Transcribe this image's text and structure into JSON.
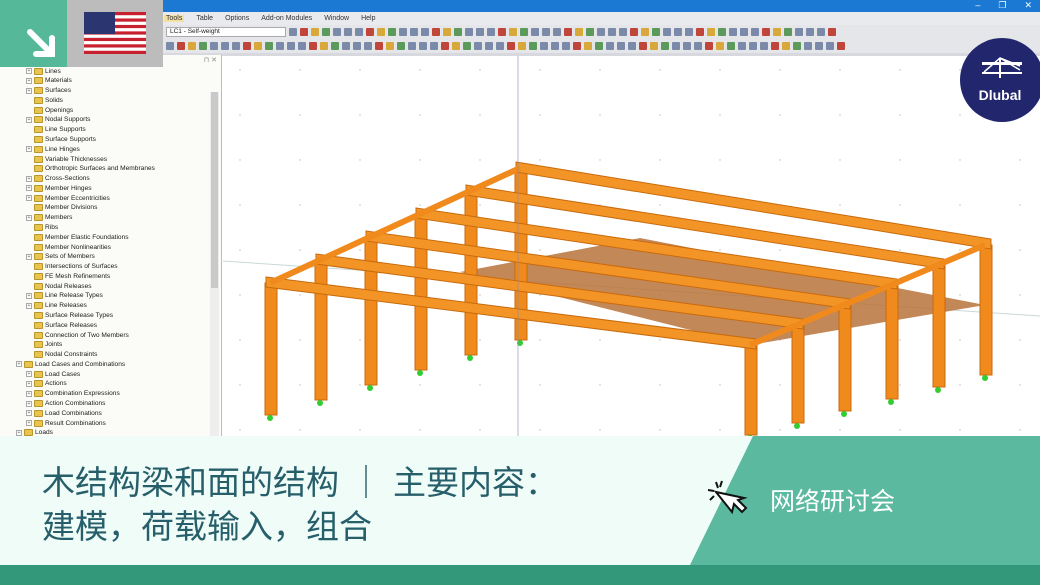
{
  "window": {
    "controls": [
      "–",
      "❐",
      "✕"
    ]
  },
  "menu": [
    "Tools",
    "Table",
    "Options",
    "Add-on Modules",
    "Window",
    "Help"
  ],
  "toolbar": {
    "load_case": "LC1 - Self-weight"
  },
  "panel": {
    "header_icons": "⊓ ✕"
  },
  "tree": [
    {
      "label": "Lines",
      "level": 2,
      "exp": true
    },
    {
      "label": "Materials",
      "level": 2,
      "exp": true
    },
    {
      "label": "Surfaces",
      "level": 2,
      "exp": true
    },
    {
      "label": "Solids",
      "level": 2,
      "exp": false
    },
    {
      "label": "Openings",
      "level": 2,
      "exp": false
    },
    {
      "label": "Nodal Supports",
      "level": 2,
      "exp": true
    },
    {
      "label": "Line Supports",
      "level": 2,
      "exp": false
    },
    {
      "label": "Surface Supports",
      "level": 2,
      "exp": false
    },
    {
      "label": "Line Hinges",
      "level": 2,
      "exp": true
    },
    {
      "label": "Variable Thicknesses",
      "level": 2,
      "exp": false
    },
    {
      "label": "Orthotropic Surfaces and Membranes",
      "level": 2,
      "exp": false
    },
    {
      "label": "Cross-Sections",
      "level": 2,
      "exp": true
    },
    {
      "label": "Member Hinges",
      "level": 2,
      "exp": true
    },
    {
      "label": "Member Eccentricities",
      "level": 2,
      "exp": true
    },
    {
      "label": "Member Divisions",
      "level": 2,
      "exp": false
    },
    {
      "label": "Members",
      "level": 2,
      "exp": true
    },
    {
      "label": "Ribs",
      "level": 2,
      "exp": false
    },
    {
      "label": "Member Elastic Foundations",
      "level": 2,
      "exp": false
    },
    {
      "label": "Member Nonlinearities",
      "level": 2,
      "exp": false
    },
    {
      "label": "Sets of Members",
      "level": 2,
      "exp": true
    },
    {
      "label": "Intersections of Surfaces",
      "level": 2,
      "exp": false
    },
    {
      "label": "FE Mesh Refinements",
      "level": 2,
      "exp": false
    },
    {
      "label": "Nodal Releases",
      "level": 2,
      "exp": false
    },
    {
      "label": "Line Release Types",
      "level": 2,
      "exp": true
    },
    {
      "label": "Line Releases",
      "level": 2,
      "exp": true
    },
    {
      "label": "Surface Release Types",
      "level": 2,
      "exp": false
    },
    {
      "label": "Surface Releases",
      "level": 2,
      "exp": false
    },
    {
      "label": "Connection of Two Members",
      "level": 2,
      "exp": false
    },
    {
      "label": "Joints",
      "level": 2,
      "exp": false
    },
    {
      "label": "Nodal Constraints",
      "level": 2,
      "exp": false
    },
    {
      "label": "Load Cases and Combinations",
      "level": 1,
      "exp": true
    },
    {
      "label": "Load Cases",
      "level": 2,
      "exp": true
    },
    {
      "label": "Actions",
      "level": 2,
      "exp": true
    },
    {
      "label": "Combination Expressions",
      "level": 2,
      "exp": true
    },
    {
      "label": "Action Combinations",
      "level": 2,
      "exp": true
    },
    {
      "label": "Load Combinations",
      "level": 2,
      "exp": true
    },
    {
      "label": "Result Combinations",
      "level": 2,
      "exp": true
    },
    {
      "label": "Loads",
      "level": 1,
      "exp": true
    }
  ],
  "logo": {
    "text": "Dlubal"
  },
  "banner": {
    "title_line1": "木结构梁和面的结构 ｜ 主要内容：",
    "title_line2": "建模，荷载输入，组合",
    "tag": "网络研讨会"
  },
  "colors": {
    "green": "#55b899",
    "dark_green": "#33977a",
    "navy": "#22266c",
    "timber": "#f08a1c"
  }
}
